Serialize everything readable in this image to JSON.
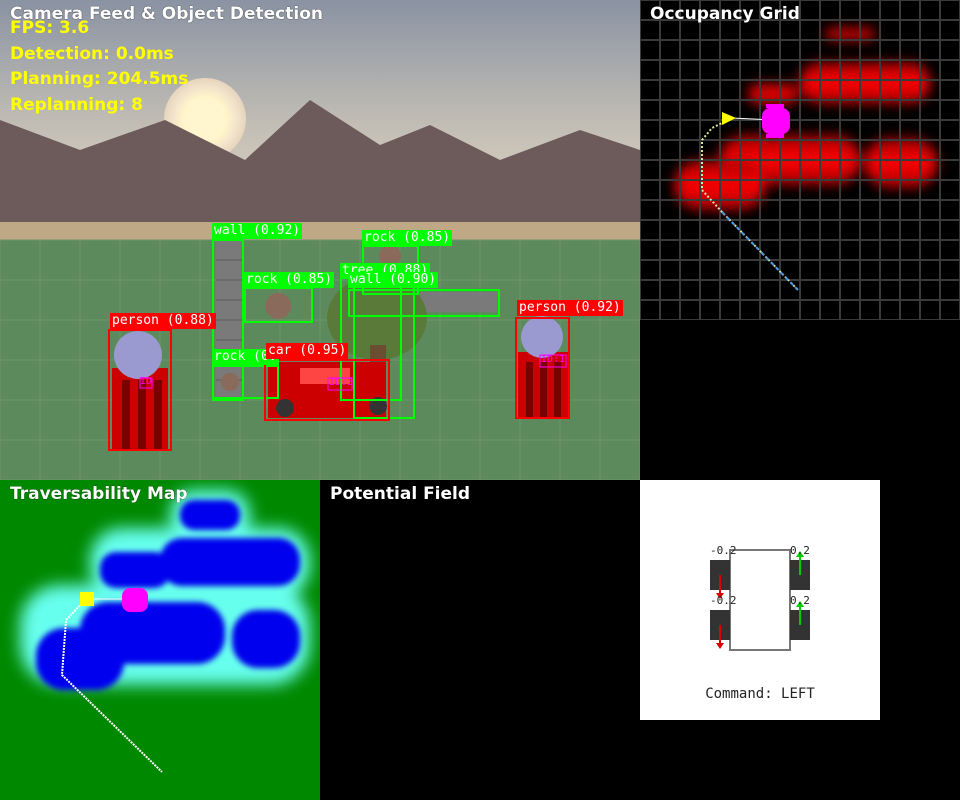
{
  "panels": {
    "camera_title": "Camera Feed & Object Detection",
    "occupancy_title": "Occupancy Grid",
    "traversability_title": "Traversability Map",
    "potential_title": "Potential Field"
  },
  "stats": {
    "fps": "FPS: 3.6",
    "detection": "Detection: 0.0ms",
    "planning": "Planning: 204.5ms",
    "replanning": "Replanning: 8"
  },
  "detections": [
    {
      "label": "wall (0.92)",
      "color": "#00ff00"
    },
    {
      "label": "rock (0.85)",
      "color": "#00ff00"
    },
    {
      "label": "rock (0.85)",
      "color": "#00ff00"
    },
    {
      "label": "tree (0.88)",
      "color": "#00ff00"
    },
    {
      "label": "wall (0.90)",
      "color": "#00ff00"
    },
    {
      "label": "rock (0.",
      "color": "#00ff00"
    },
    {
      "label": "car (0.95)",
      "color": "#ff0000"
    },
    {
      "label": "person (0.88)",
      "color": "#ff0000"
    },
    {
      "label": "person (0.92)",
      "color": "#ff0000"
    }
  ],
  "id_tags": [
    "ID",
    "ID:3",
    "ID:1"
  ],
  "robot": {
    "command": "Command: LEFT",
    "wheel_fl": "-0.2",
    "wheel_fr": "0.2",
    "wheel_rl": "-0.2",
    "wheel_rr": "0.2"
  },
  "colors": {
    "stats": "#ffff00",
    "obstacle_box": "#00ff00",
    "dynamic_box": "#ff0000",
    "path": "#ffff00",
    "goal": "#ff00ff"
  }
}
